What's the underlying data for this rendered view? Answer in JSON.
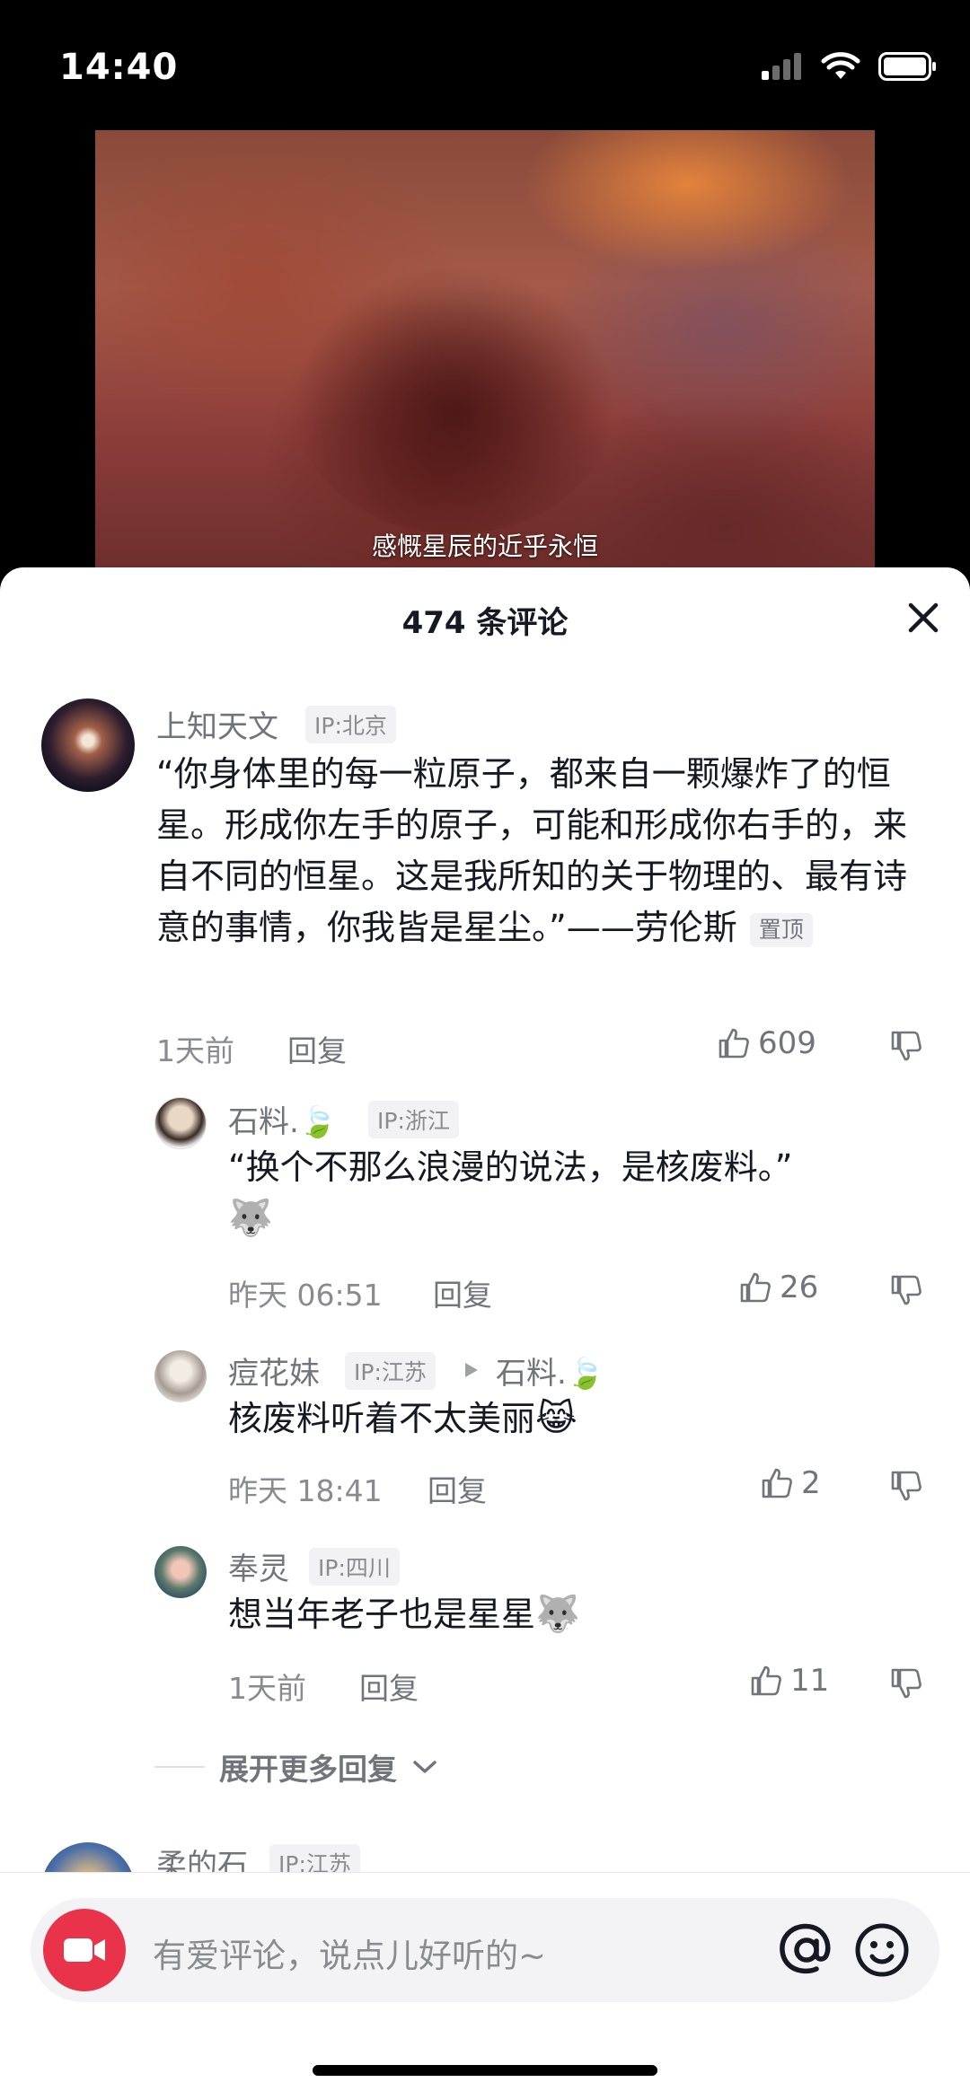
{
  "status": {
    "time": "14:40"
  },
  "video": {
    "subtitle": "感慨星辰的近乎永恒"
  },
  "sheet": {
    "title": "474 条评论"
  },
  "comments": [
    {
      "username": "上知天文",
      "ip": "IP:北京",
      "text": "“你身体里的每一粒原子，都来自一颗爆炸了的恒星。形成你左手的原子，可能和形成你右手的，来自不同的恒星。这是我所知的关于物理的、最有诗意的事情，你我皆是星尘。”——劳伦斯",
      "pin": "置顶",
      "time": "1天前",
      "reply": "回复",
      "likes": "609"
    },
    {
      "username": "石料.",
      "ip": "IP:浙江",
      "text": "“换个不那么浪漫的说法，是核废料。”",
      "time": "昨天 06:51",
      "reply": "回复",
      "likes": "26"
    },
    {
      "username": "痘花妹",
      "ip": "IP:江苏",
      "reply_to": "石料.",
      "text": "核废料听着不太美丽",
      "time": "昨天 18:41",
      "reply": "回复",
      "likes": "2"
    },
    {
      "username": "奉灵",
      "ip": "IP:四川",
      "text": "想当年老子也是星星",
      "time": "1天前",
      "reply": "回复",
      "likes": "11"
    },
    {
      "username": "柔的石",
      "ip": "IP:江苏"
    }
  ],
  "expand": {
    "label": "展开更多回复"
  },
  "input": {
    "placeholder": "有爱评论，说点儿好听的~"
  },
  "colors": {
    "camera": "#e8334b",
    "text": "#161823",
    "muted": "#8a8b91"
  }
}
